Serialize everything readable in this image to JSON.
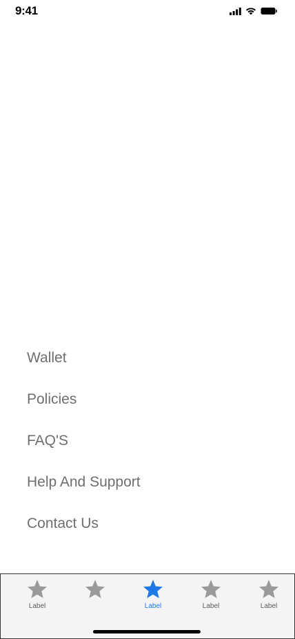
{
  "status_bar": {
    "time": "9:41",
    "icons": [
      "cellular-signal-icon",
      "wifi-icon",
      "battery-icon"
    ]
  },
  "menu": {
    "items": [
      {
        "label": "Wallet"
      },
      {
        "label": "Policies"
      },
      {
        "label": "FAQ'S"
      },
      {
        "label": "Help And Support"
      },
      {
        "label": "Contact Us"
      }
    ]
  },
  "tab_bar": {
    "active_index": 2,
    "colors": {
      "inactive_icon": "#9a9a9a",
      "active_icon": "#1e78e6"
    },
    "tabs": [
      {
        "label": "Label",
        "icon": "star-icon"
      },
      {
        "label": "",
        "icon": "star-icon"
      },
      {
        "label": "Label",
        "icon": "star-icon"
      },
      {
        "label": "Label",
        "icon": "star-icon"
      },
      {
        "label": "Label",
        "icon": "star-icon"
      }
    ]
  }
}
